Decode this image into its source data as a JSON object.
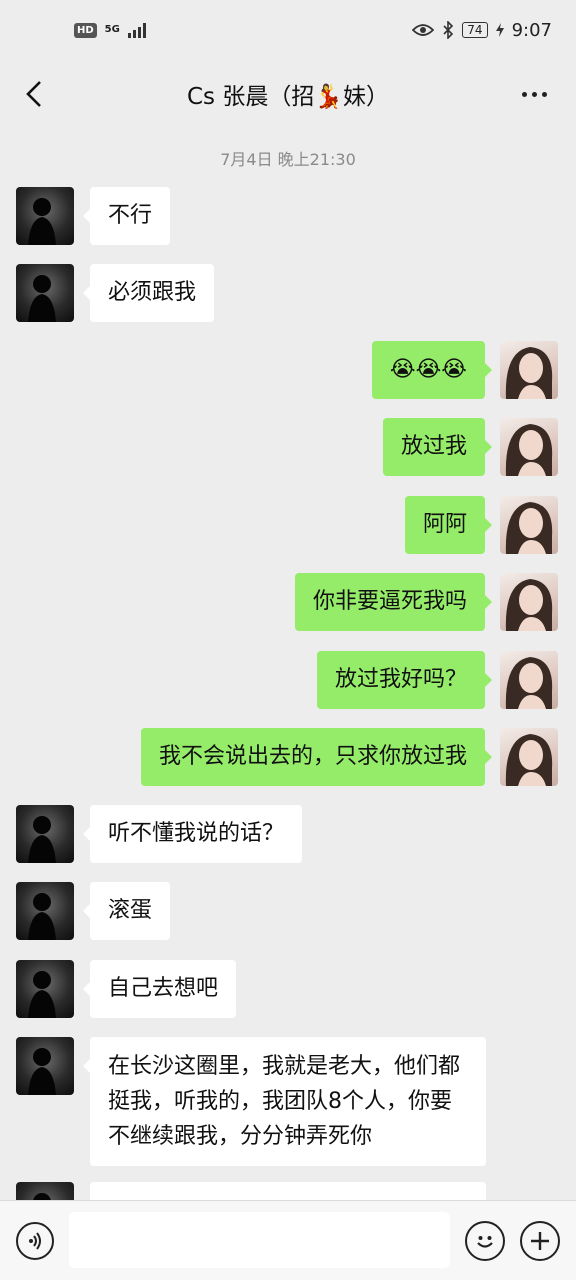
{
  "status_bar": {
    "hd": "HD",
    "network": "5G",
    "battery": "74",
    "time": "9:07"
  },
  "header": {
    "title": "Cs 张晨（招💃妹）"
  },
  "timestamp": "7月4日 晚上21:30",
  "messages": [
    {
      "side": "in",
      "text": "不行"
    },
    {
      "side": "in",
      "text": "必须跟我"
    },
    {
      "side": "out",
      "text": "😭😭😭"
    },
    {
      "side": "out",
      "text": "放过我"
    },
    {
      "side": "out",
      "text": "阿阿"
    },
    {
      "side": "out",
      "text": "你非要逼死我吗"
    },
    {
      "side": "out",
      "text": "放过我好吗？"
    },
    {
      "side": "out",
      "text": "我不会说出去的，只求你放过我"
    },
    {
      "side": "in",
      "text": "听不懂我说的话？"
    },
    {
      "side": "in",
      "text": "滚蛋"
    },
    {
      "side": "in",
      "text": "自己去想吧"
    },
    {
      "side": "in",
      "text": "在长沙这圈里，我就是老大，他们都挺我，听我的，我团队8个人，你要不继续跟我，分分钟弄死你"
    }
  ],
  "input": {
    "placeholder": ""
  },
  "colors": {
    "sent_bubble": "#95ec69",
    "received_bubble": "#ffffff",
    "background": "#ededed"
  }
}
